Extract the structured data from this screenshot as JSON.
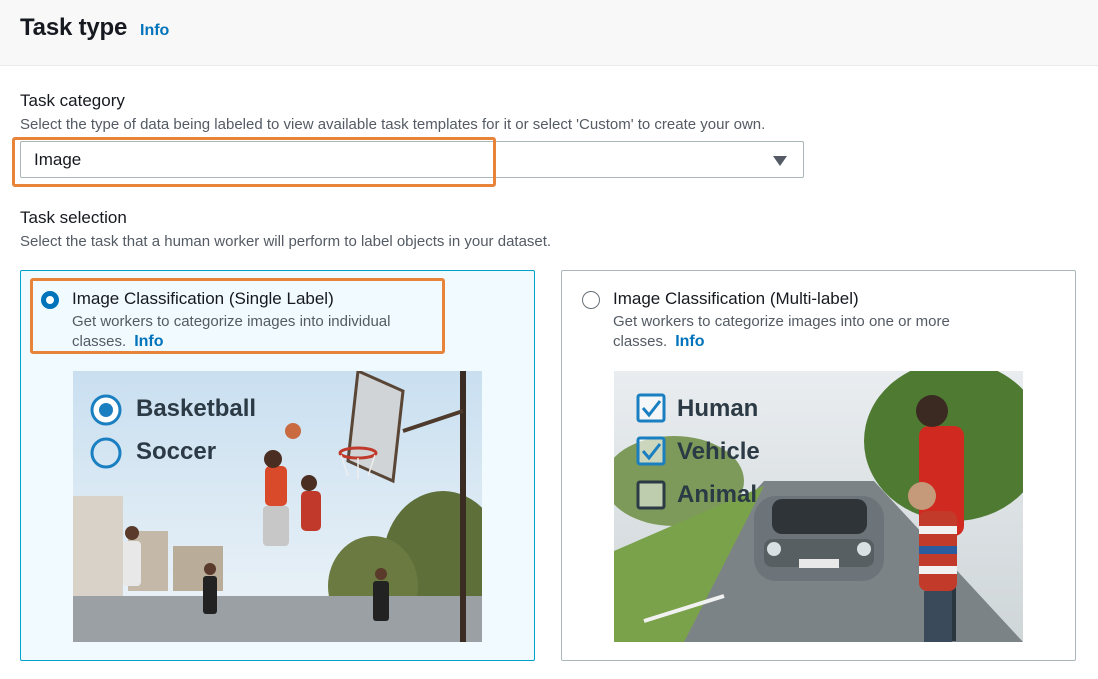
{
  "header": {
    "title": "Task type",
    "info": "Info"
  },
  "task_category": {
    "label": "Task category",
    "description": "Select the type of data being labeled to view available task templates for it or select 'Custom' to create your own.",
    "selected_value": "Image"
  },
  "task_selection": {
    "label": "Task selection",
    "description": "Select the task that a human worker will perform to label objects in your dataset.",
    "tiles": [
      {
        "title": "Image Classification (Single Label)",
        "description": "Get workers to categorize images into individual classes.",
        "info": "Info",
        "selected": true,
        "example_options": [
          {
            "label": "Basketball",
            "checked": true
          },
          {
            "label": "Soccer",
            "checked": false
          }
        ]
      },
      {
        "title": "Image Classification (Multi-label)",
        "description": "Get workers to categorize images into one or more classes.",
        "info": "Info",
        "selected": false,
        "example_options": [
          {
            "label": "Human",
            "checked": true
          },
          {
            "label": "Vehicle",
            "checked": true
          },
          {
            "label": "Animal",
            "checked": false
          }
        ]
      }
    ]
  },
  "colors": {
    "link": "#0073bb",
    "selected_tile_bg": "#f1faff",
    "selected_tile_border": "#00a1c9",
    "highlight": "#e8833a"
  }
}
